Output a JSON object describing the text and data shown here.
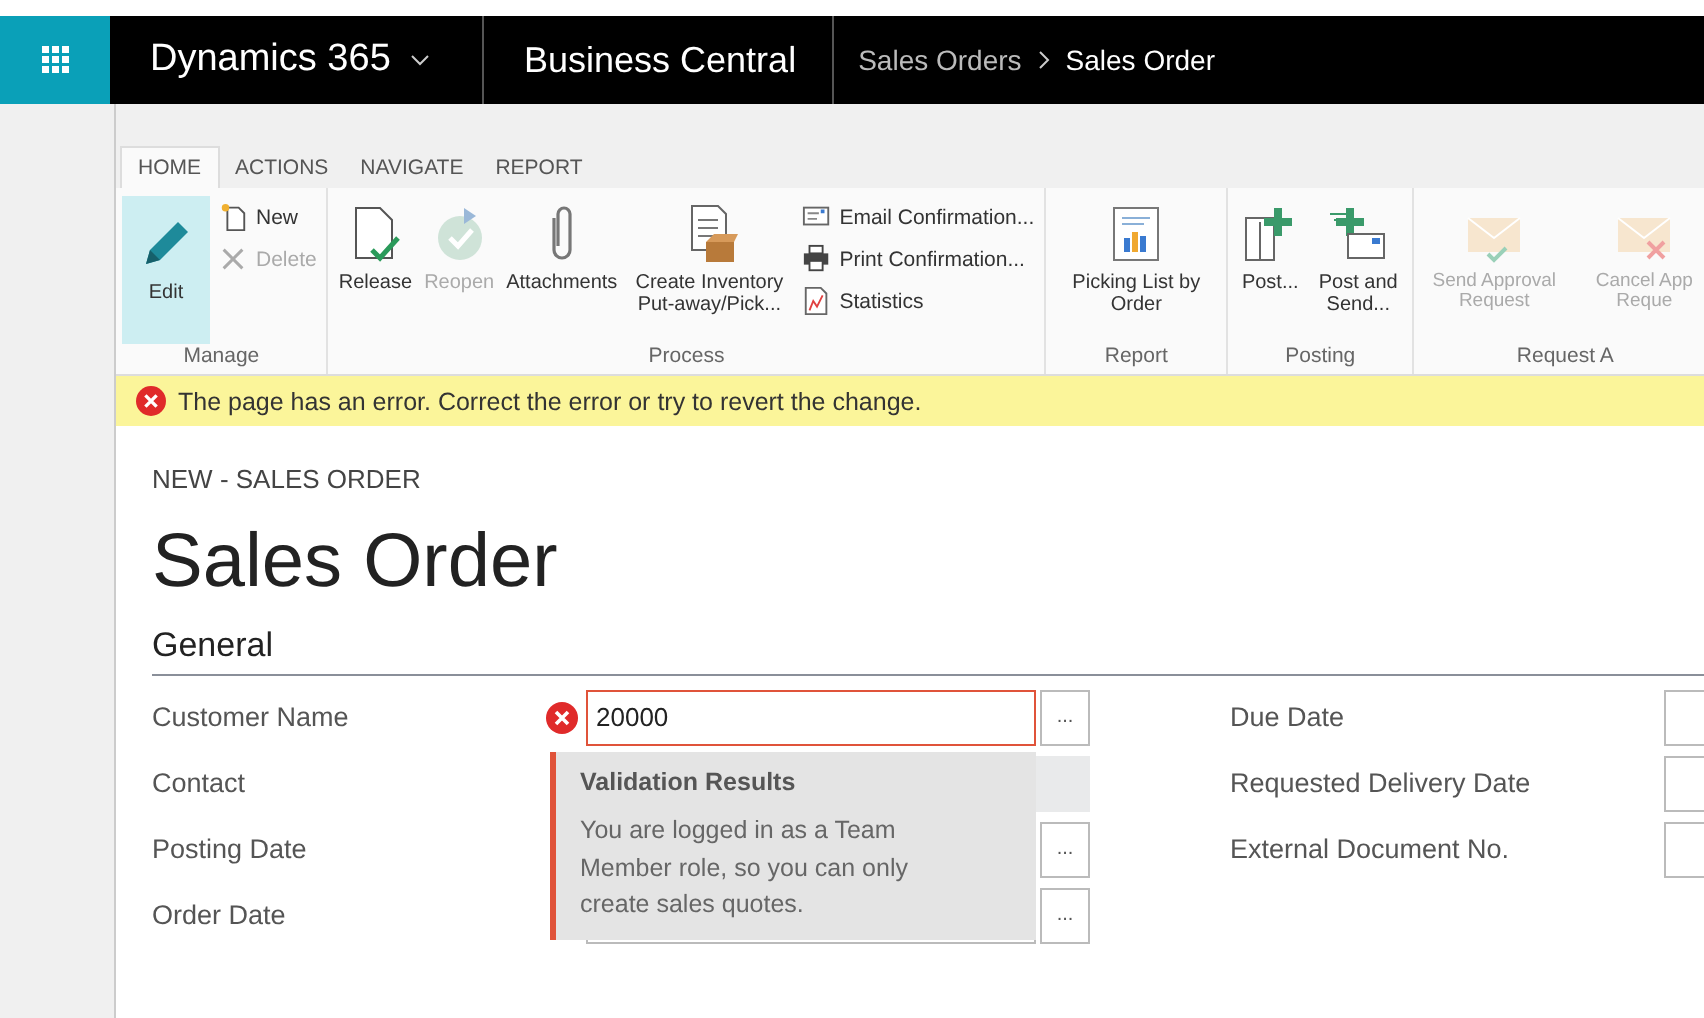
{
  "app_bar": {
    "product": "Dynamics 365",
    "app": "Business Central",
    "breadcrumb": [
      {
        "label": "Sales Orders",
        "selected": false
      },
      {
        "label": "Sales Order",
        "selected": true
      }
    ]
  },
  "ribbon": {
    "tabs": [
      {
        "label": "HOME",
        "selected": true
      },
      {
        "label": "ACTIONS",
        "selected": false
      },
      {
        "label": "NAVIGATE",
        "selected": false
      },
      {
        "label": "REPORT",
        "selected": false
      }
    ],
    "groups": [
      {
        "label": "Manage",
        "items": [
          {
            "kind": "large",
            "label": "Edit",
            "selected": true,
            "disabled": false
          },
          {
            "kind": "small",
            "label": "New",
            "disabled": false
          },
          {
            "kind": "small",
            "label": "Delete",
            "disabled": true
          }
        ]
      },
      {
        "label": "Process",
        "items": [
          {
            "kind": "large",
            "label": "Release",
            "selected": false,
            "disabled": false
          },
          {
            "kind": "large",
            "label": "Reopen",
            "selected": false,
            "disabled": true
          },
          {
            "kind": "large",
            "label": "Attachments",
            "selected": false,
            "disabled": false
          },
          {
            "kind": "large",
            "label": "Create Inventory Put-away/Pick...",
            "selected": false,
            "disabled": false
          },
          {
            "kind": "small",
            "label": "Email Confirmation...",
            "disabled": false
          },
          {
            "kind": "small",
            "label": "Print Confirmation...",
            "disabled": false
          },
          {
            "kind": "small",
            "label": "Statistics",
            "disabled": false
          }
        ]
      },
      {
        "label": "Report",
        "items": [
          {
            "kind": "large",
            "label": "Picking List by Order",
            "selected": false,
            "disabled": false
          }
        ]
      },
      {
        "label": "Posting",
        "items": [
          {
            "kind": "large",
            "label": "Post...",
            "selected": false,
            "disabled": false
          },
          {
            "kind": "large",
            "label": "Post and Send...",
            "selected": false,
            "disabled": false
          }
        ]
      },
      {
        "label": "Request A",
        "items": [
          {
            "kind": "large",
            "label": "Send Approval Request",
            "selected": false,
            "disabled": true
          },
          {
            "kind": "large",
            "label": "Cancel App Reque",
            "selected": false,
            "disabled": true
          }
        ]
      }
    ]
  },
  "error_bar": {
    "message": "The page has an error. Correct the error or try to revert the change."
  },
  "page": {
    "caption": "NEW - SALES ORDER",
    "title": "Sales Order",
    "section": "General"
  },
  "fields_left": [
    {
      "label": "Customer Name",
      "value": "20000",
      "error": true,
      "readonly": false,
      "lookup": true
    },
    {
      "label": "Contact",
      "error": false,
      "readonly": true,
      "lookup": false
    },
    {
      "label": "Posting Date",
      "error": false,
      "readonly": false,
      "lookup": true
    },
    {
      "label": "Order Date",
      "error": false,
      "readonly": false,
      "lookup": true
    }
  ],
  "fields_right": [
    {
      "label": "Due Date"
    },
    {
      "label": "Requested Delivery Date"
    },
    {
      "label": "External Document No."
    }
  ],
  "lookup_label": "...",
  "validation": {
    "title": "Validation Results",
    "message": "You are logged in as a Team Member role, so you can only create sales quotes."
  }
}
